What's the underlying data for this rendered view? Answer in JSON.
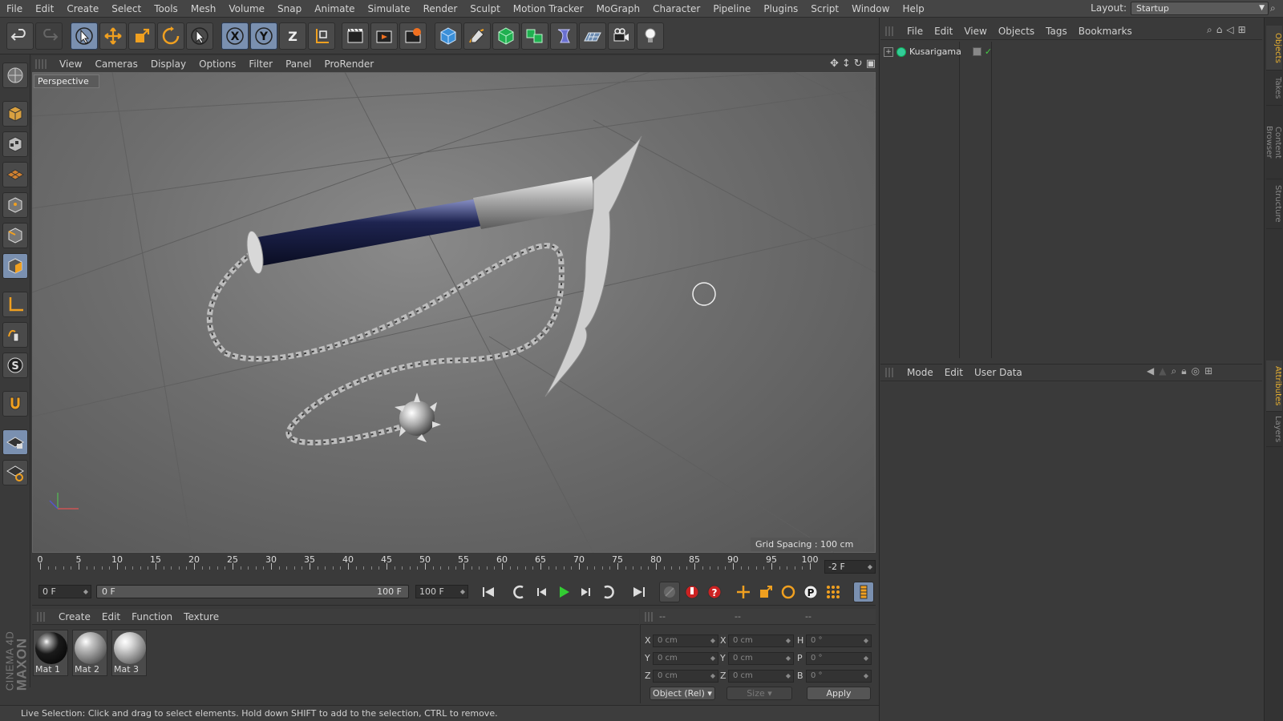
{
  "menubar": {
    "items": [
      "File",
      "Edit",
      "Create",
      "Select",
      "Tools",
      "Mesh",
      "Volume",
      "Snap",
      "Animate",
      "Simulate",
      "Render",
      "Sculpt",
      "Motion Tracker",
      "MoGraph",
      "Character",
      "Pipeline",
      "Plugins",
      "Script",
      "Window",
      "Help"
    ],
    "layout_label": "Layout:",
    "layout_value": "Startup"
  },
  "toolbar": {
    "tools": [
      "undo-icon",
      "redo-icon",
      "live-selection-icon",
      "move-icon",
      "scale-icon",
      "rotate-icon",
      "recent-tool-icon",
      "x-axis-icon",
      "y-axis-icon",
      "z-axis-icon",
      "coordinate-system-icon",
      "render-view-icon",
      "render-picture-viewer-icon",
      "render-settings-icon",
      "cube-icon",
      "pen-icon",
      "subdivision-icon",
      "array-icon",
      "deformer-icon",
      "floor-icon",
      "camera-icon",
      "light-icon"
    ],
    "axis_labels": {
      "x": "X",
      "y": "Y",
      "z": "Z"
    }
  },
  "viewport": {
    "menu": [
      "View",
      "Cameras",
      "Display",
      "Options",
      "Filter",
      "Panel",
      "ProRender"
    ],
    "label": "Perspective",
    "grid_spacing": "Grid Spacing : 100 cm"
  },
  "timeline": {
    "ticks": [
      "0",
      "5",
      "10",
      "15",
      "20",
      "25",
      "30",
      "35",
      "40",
      "45",
      "50",
      "55",
      "60",
      "65",
      "70",
      "75",
      "80",
      "85",
      "90",
      "95",
      "100"
    ],
    "current_frame": "-2 F",
    "start_field": "0 F",
    "range_start": "0 F",
    "range_end": "100 F",
    "end_field": "100 F"
  },
  "materials": {
    "menu": [
      "Create",
      "Edit",
      "Function",
      "Texture"
    ],
    "items": [
      {
        "name": "Mat 1",
        "color": "#1a1a1a"
      },
      {
        "name": "Mat 2",
        "color": "#c8c8c8"
      },
      {
        "name": "Mat 3",
        "color": "#dcdcdc"
      }
    ]
  },
  "coordinates": {
    "headers": [
      "--",
      "--",
      "--"
    ],
    "rows": [
      {
        "pos_axis": "X",
        "pos": "0 cm",
        "size_axis": "X",
        "size": "0 cm",
        "rot_axis": "H",
        "rot": "0 °"
      },
      {
        "pos_axis": "Y",
        "pos": "0 cm",
        "size_axis": "Y",
        "size": "0 cm",
        "rot_axis": "P",
        "rot": "0 °"
      },
      {
        "pos_axis": "Z",
        "pos": "0 cm",
        "size_axis": "Z",
        "size": "0 cm",
        "rot_axis": "B",
        "rot": "0 °"
      }
    ],
    "mode_select": "Object (Rel)",
    "size_select": "Size",
    "apply": "Apply"
  },
  "object_manager": {
    "menu": [
      "File",
      "Edit",
      "View",
      "Objects",
      "Tags",
      "Bookmarks"
    ],
    "objects": [
      {
        "name": "Kusarigama"
      }
    ]
  },
  "attributes": {
    "menu": [
      "Mode",
      "Edit",
      "User Data"
    ]
  },
  "sidetabs": [
    "Objects",
    "Takes",
    "Content Browser",
    "Structure",
    "Attributes",
    "Layers"
  ],
  "statusbar": "Live Selection: Click and drag to select elements. Hold down SHIFT to add to the selection, CTRL to remove.",
  "branding": {
    "line1": "MAXON",
    "line2": "CINEMA 4D"
  }
}
